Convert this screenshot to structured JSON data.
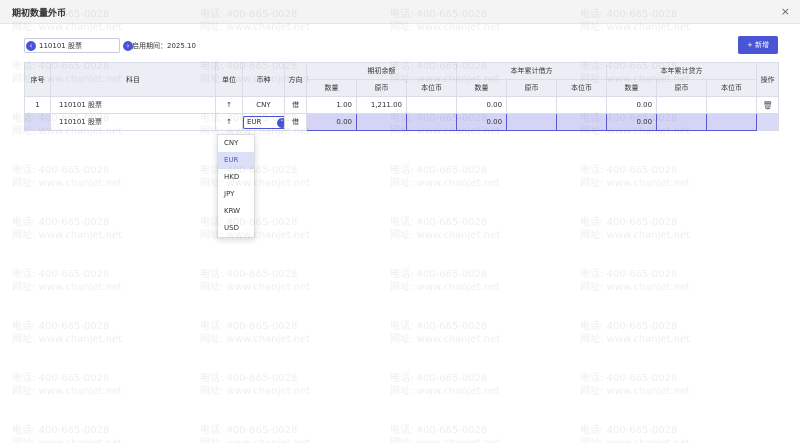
{
  "dialog": {
    "title": "期初数量外币",
    "close_label": "×"
  },
  "toolbar": {
    "subject_value": "110101 股票",
    "prev_label": "‹",
    "next_label": "›",
    "period_label": "启用期间：",
    "period_value": "2025.10",
    "add_label": "+ 新增"
  },
  "table": {
    "headers": {
      "seq": "序号",
      "subject": "科目",
      "unit": "单位",
      "currency": "币种",
      "direction": "方向",
      "opening": "期初余额",
      "debit": "本年累计借方",
      "credit": "本年累计贷方",
      "action": "操作",
      "qty": "数量",
      "orig": "原币",
      "local": "本位币"
    },
    "rows": [
      {
        "seq": "1",
        "subject": "110101 股票",
        "unit": "↑",
        "currency": "CNY",
        "direction": "借",
        "open_qty": "1.00",
        "open_orig": "1,211.00",
        "open_local": "",
        "debit_qty": "0.00",
        "debit_orig": "",
        "debit_local": "",
        "credit_qty": "0.00",
        "credit_orig": "",
        "credit_local": "",
        "action_icon": "🗑"
      },
      {
        "seq": "",
        "subject": "110101 股票",
        "unit": "↑",
        "currency": "EUR",
        "direction": "借",
        "open_qty": "0.00",
        "open_orig": "",
        "open_local": "",
        "debit_qty": "0.00",
        "debit_orig": "",
        "debit_local": "",
        "credit_qty": "0.00",
        "credit_orig": "",
        "credit_local": ""
      }
    ]
  },
  "currency_dropdown": {
    "chevron": "⌃",
    "options": [
      "CNY",
      "EUR",
      "HKD",
      "JPY",
      "KRW",
      "USD"
    ],
    "selected": "EUR"
  },
  "watermark": {
    "line1": "电话: 400-665-0028",
    "line2": "网址: www.chanjet.net"
  },
  "colors": {
    "accent": "#4a55d6",
    "selected_row": "#d9daf6",
    "header_bg": "#eceef5"
  }
}
